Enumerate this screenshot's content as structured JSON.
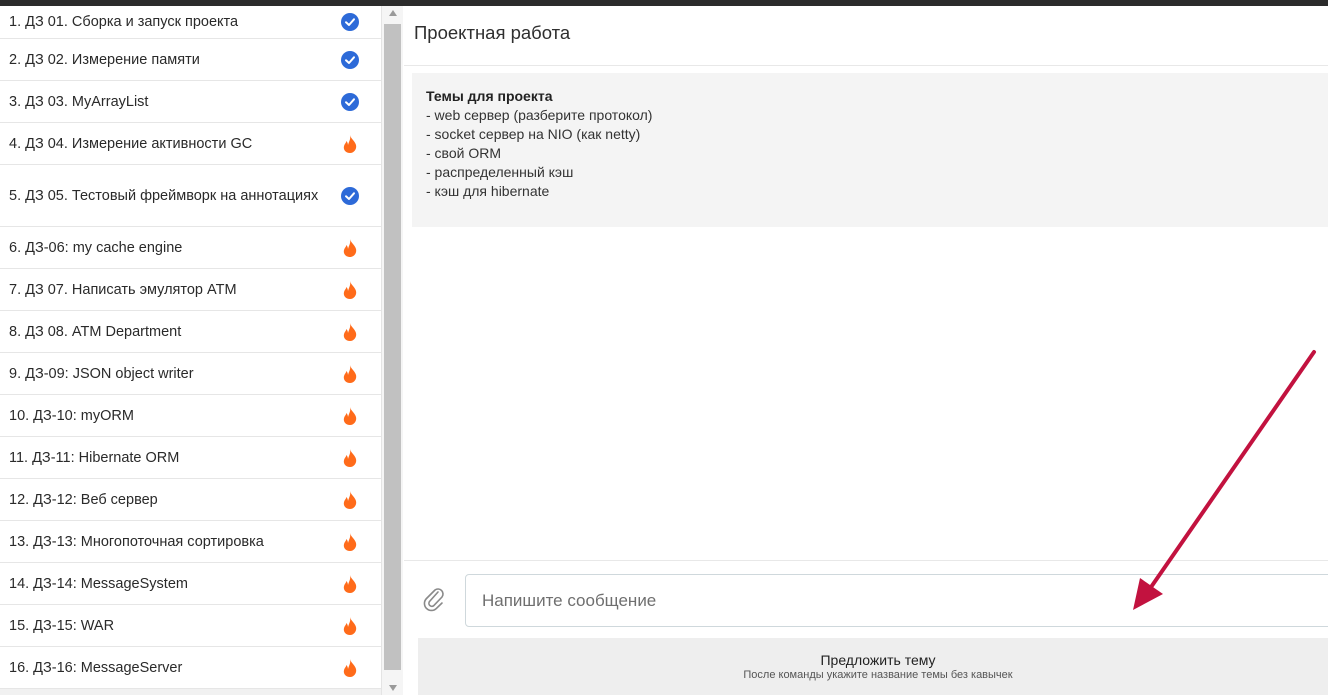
{
  "sidebar": {
    "items": [
      {
        "label": "1. ДЗ 01. Сборка и запуск проекта",
        "status": "done"
      },
      {
        "label": "2. ДЗ 02. Измерение памяти",
        "status": "done"
      },
      {
        "label": "3. ДЗ 03. MyArrayList",
        "status": "done"
      },
      {
        "label": "4. ДЗ 04. Измерение активности GC",
        "status": "hot"
      },
      {
        "label": "5. ДЗ 05. Тестовый фреймворк на аннотациях",
        "status": "done"
      },
      {
        "label": "6. ДЗ-06: my cache engine",
        "status": "hot"
      },
      {
        "label": "7. ДЗ 07. Написать эмулятор ATM",
        "status": "hot"
      },
      {
        "label": "8. ДЗ 08. ATM Department",
        "status": "hot"
      },
      {
        "label": "9. ДЗ-09: JSON object writer",
        "status": "hot"
      },
      {
        "label": "10. ДЗ-10: myORM",
        "status": "hot"
      },
      {
        "label": "11. ДЗ-11: Hibernate ORM",
        "status": "hot"
      },
      {
        "label": "12. ДЗ-12: Веб сервер",
        "status": "hot"
      },
      {
        "label": "13. ДЗ-13: Многопоточная сортировка",
        "status": "hot"
      },
      {
        "label": "14. ДЗ-14: MessageSystem",
        "status": "hot"
      },
      {
        "label": "15. ДЗ-15: WAR",
        "status": "hot"
      },
      {
        "label": "16. ДЗ-16: MessageServer",
        "status": "hot"
      }
    ],
    "status_icons": {
      "done": "check-circle-icon",
      "hot": "flame-icon"
    }
  },
  "main": {
    "title": "Проектная работа",
    "message": {
      "heading": "Темы для проекта",
      "lines": [
        "- web сервер (разберите протокол)",
        "- socket сервер на NIO (как netty)",
        "- свой ORM",
        "- распределенный кэш",
        "- кэш для hibernate"
      ]
    },
    "composer": {
      "placeholder": "Напишите сообщение",
      "value": ""
    },
    "suggest_button": {
      "title": "Предложить тему",
      "subtitle": "После команды укажите название темы без кавычек"
    }
  },
  "colors": {
    "done": "#2d6ad8",
    "hot": "#ff6b1a",
    "arrow": "#c2123f",
    "topbar": "#2b2b2b"
  }
}
